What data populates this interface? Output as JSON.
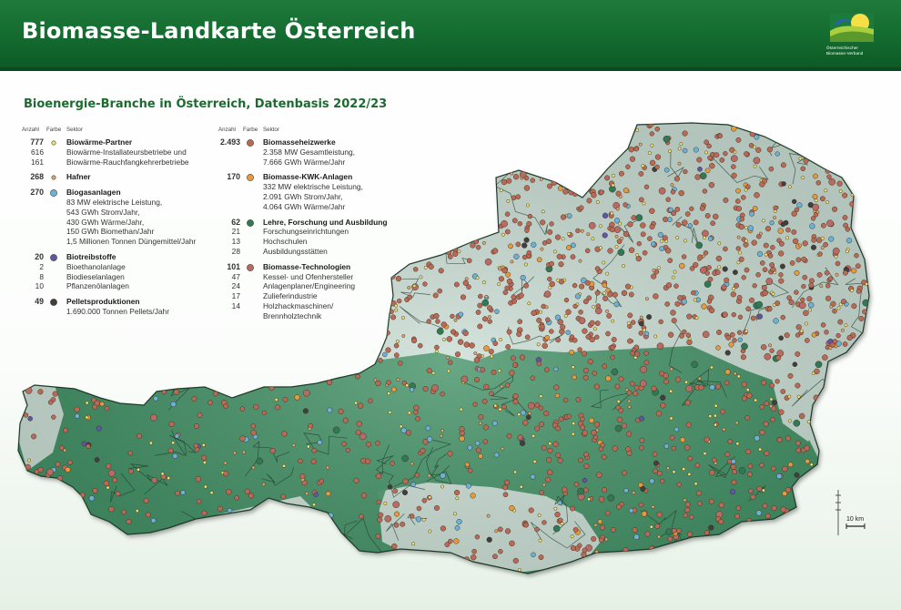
{
  "header": {
    "title": "Biomasse-Landkarte Österreich",
    "logo_line1": "Österreichischer",
    "logo_line2": "Biomasse-Verband"
  },
  "subtitle": "Bioenergie-Branche in Österreich, Datenbasis 2022/23",
  "legend": {
    "col_headers": {
      "count": "Anzahl",
      "color": "Farbe",
      "sector": "Sektor"
    },
    "left": [
      {
        "count": "777",
        "label": "Biowärme-Partner",
        "color": "#f1e46a",
        "sub": [
          {
            "count": "616",
            "label": "Biowärme-Installateursbetriebe und"
          },
          {
            "count": "161",
            "label": "Biowärme-Rauchfangkehrerbetriebe"
          }
        ]
      },
      {
        "count": "268",
        "label": "Hafner",
        "color": "#e0a86a",
        "sub": []
      },
      {
        "count": "270",
        "label": "Biogasanlagen",
        "color": "#6ab2d6",
        "sub": [
          {
            "count": "",
            "label": "83 MW elektrische Leistung,"
          },
          {
            "count": "",
            "label": "543 GWh Strom/Jahr,"
          },
          {
            "count": "",
            "label": "430 GWh Wärme/Jahr,"
          },
          {
            "count": "",
            "label": "150 GWh Biomethan/Jahr"
          },
          {
            "count": "",
            "label": "1,5 Millionen Tonnen Düngemittel/Jahr"
          }
        ]
      },
      {
        "count": "20",
        "label": "Biotreibstoffe",
        "color": "#5e57a6",
        "sub": [
          {
            "count": "2",
            "label": "Bioethanolanlage"
          },
          {
            "count": "8",
            "label": "Biodieselanlagen"
          },
          {
            "count": "10",
            "label": "Pflanzenölanlagen"
          }
        ]
      },
      {
        "count": "49",
        "label": "Pelletsproduktionen",
        "color": "#3f3f3f",
        "sub": [
          {
            "count": "",
            "label": "1.690.000 Tonnen Pellets/Jahr"
          }
        ]
      }
    ],
    "right": [
      {
        "count": "2.493",
        "label": "Biomasseheizwerke",
        "color": "#b86a55",
        "sub": [
          {
            "count": "",
            "label": "2.358 MW Gesamtleistung,"
          },
          {
            "count": "",
            "label": "7.666 GWh Wärme/Jahr"
          }
        ]
      },
      {
        "count": "170",
        "label": "Biomasse-KWK-Anlagen",
        "color": "#e59a3b",
        "sub": [
          {
            "count": "",
            "label": "332 MW elektrische Leistung,"
          },
          {
            "count": "",
            "label": "2.091 GWh Strom/Jahr,"
          },
          {
            "count": "",
            "label": "4.064 GWh Wärme/Jahr"
          }
        ]
      },
      {
        "count": "62",
        "label": "Lehre, Forschung und Ausbildung",
        "color": "#2f7a55",
        "sub": [
          {
            "count": "21",
            "label": "Forschungseinrichtungen"
          },
          {
            "count": "13",
            "label": "Hochschulen"
          },
          {
            "count": "28",
            "label": "Ausbildungsstätten"
          }
        ]
      },
      {
        "count": "101",
        "label": "Biomasse-Technologien",
        "color": "#b76b62",
        "sub": [
          {
            "count": "47",
            "label": "Kessel- und Ofenhersteller"
          },
          {
            "count": "24",
            "label": "Anlagenplaner/Engineering"
          },
          {
            "count": "17",
            "label": "Zulieferindustrie"
          },
          {
            "count": "14",
            "label": "Holzhackmaschinen/"
          },
          {
            "count": "",
            "label": "Brennholztechnik"
          }
        ]
      }
    ]
  },
  "scale_label": "10 km",
  "colors": {
    "header_green": "#146b30",
    "title_green": "#1b6b2f",
    "region_dark": "#3f8f63",
    "region_light": "#c9ddd3",
    "district_line": "#1f3b2a"
  }
}
